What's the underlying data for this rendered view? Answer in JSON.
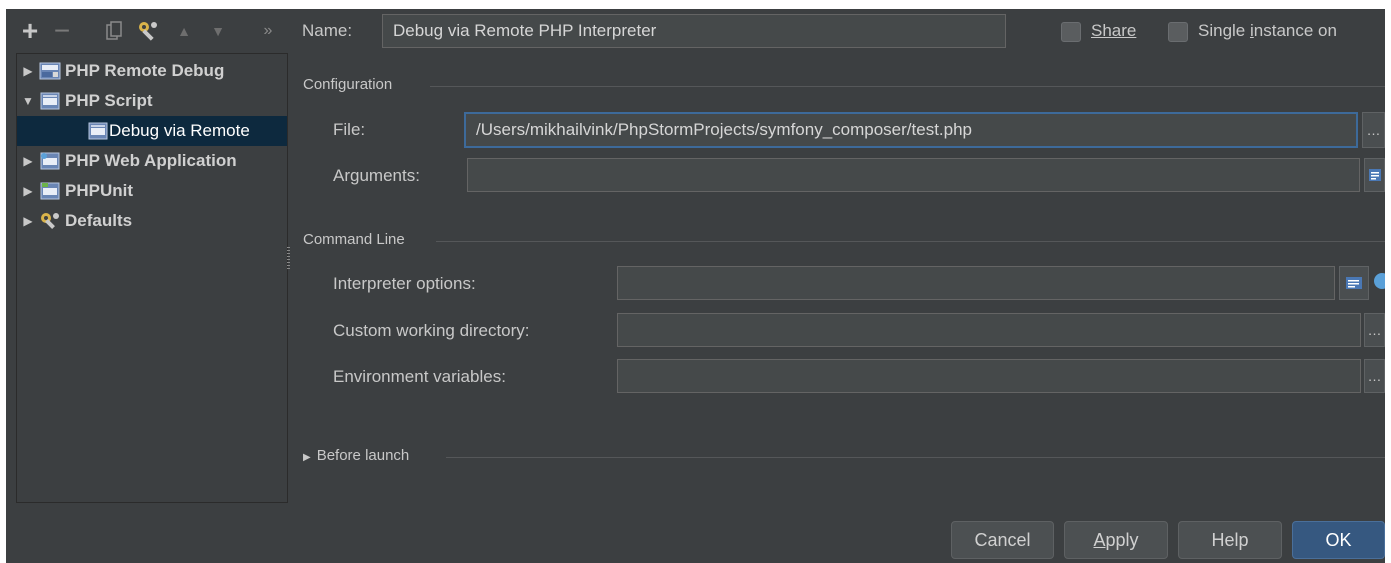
{
  "toolbar": {
    "add": "+",
    "remove": "−",
    "up": "▲",
    "down": "▼",
    "more": "»"
  },
  "tree": {
    "items": [
      {
        "label": "PHP Remote Debug",
        "icon": "php-remote-debug-icon"
      },
      {
        "label": "PHP Script",
        "icon": "php-script-icon"
      },
      {
        "label": "Debug via Remote",
        "icon": "php-script-icon"
      },
      {
        "label": "PHP Web Application",
        "icon": "php-web-app-icon"
      },
      {
        "label": "PHPUnit",
        "icon": "phpunit-icon"
      },
      {
        "label": "Defaults",
        "icon": "wrench-icon"
      }
    ]
  },
  "header": {
    "name_label": "Name:",
    "name_value": "Debug via Remote PHP Interpreter",
    "share_label": "Share",
    "single_instance_label_pre": "Single ",
    "single_instance_label_key": "i",
    "single_instance_label_post": "nstance on"
  },
  "configuration": {
    "section_title": "Configuration",
    "file_label": "File:",
    "file_value": "/Users/mikhailvink/PhpStormProjects/symfony_composer/test.php",
    "arguments_label": "Arguments:",
    "arguments_value": ""
  },
  "command_line": {
    "section_title": "Command Line",
    "interpreter_options_label": "Interpreter options:",
    "interpreter_options_value": "",
    "working_dir_label": "Custom working directory:",
    "working_dir_value": "",
    "env_vars_label": "Environment variables:",
    "env_vars_value": ""
  },
  "before_launch": {
    "title": "Before launch"
  },
  "buttons": {
    "cancel": "Cancel",
    "apply_key": "A",
    "apply_rest": "pply",
    "help": "Help",
    "ok": "OK"
  }
}
